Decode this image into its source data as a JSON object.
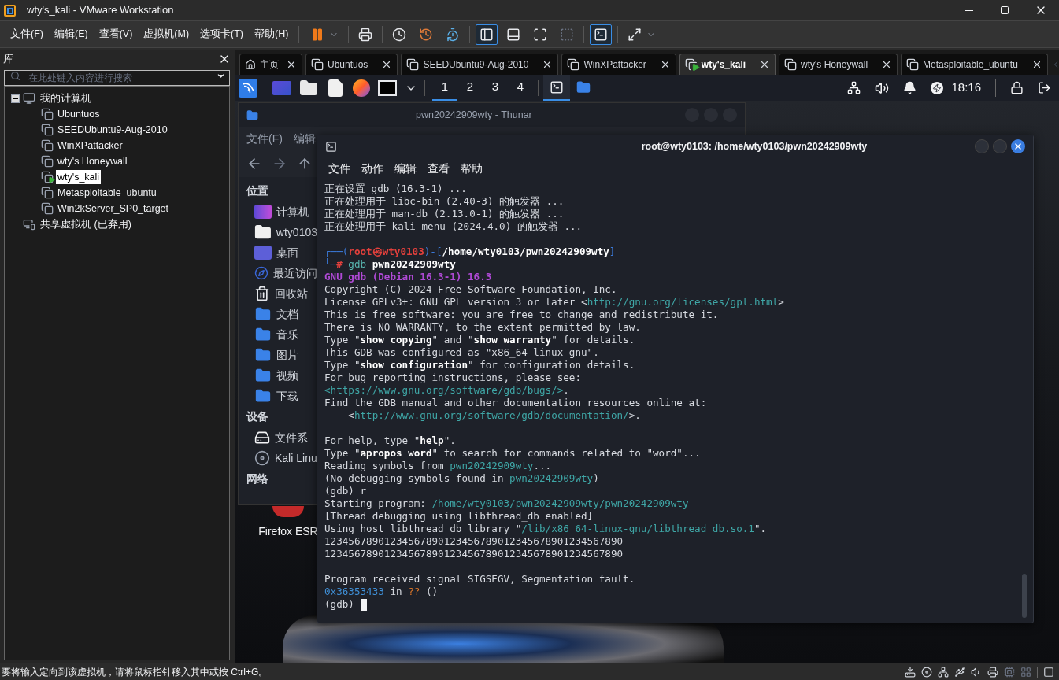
{
  "window": {
    "title": "wty's_kali - VMware Workstation"
  },
  "menu": [
    "文件(F)",
    "编辑(E)",
    "查看(V)",
    "虚拟机(M)",
    "选项卡(T)",
    "帮助(H)"
  ],
  "toolbar": [
    {
      "kind": "pause",
      "selected": false
    },
    {
      "kind": "send-keys",
      "selected": false
    },
    {
      "kind": "snapshot",
      "selected": false
    },
    {
      "kind": "revert",
      "selected": false
    },
    {
      "kind": "manage-snapshots",
      "selected": false
    },
    {
      "kind": "library",
      "selected": true
    },
    {
      "kind": "thumbnails",
      "selected": false
    },
    {
      "kind": "fullscreen",
      "selected": false
    },
    {
      "kind": "unity",
      "selected": false
    },
    {
      "kind": "console",
      "selected": true
    },
    {
      "kind": "stretch",
      "selected": false
    }
  ],
  "library": {
    "title": "库",
    "search": {
      "placeholder": "在此处键入内容进行搜索"
    },
    "tree": [
      {
        "label": "我的计算机",
        "kind": "computer",
        "expanded": true,
        "children": [
          {
            "label": "Ubuntuos",
            "selected": false,
            "running": false
          },
          {
            "label": "SEEDUbuntu9-Aug-2010",
            "selected": false,
            "running": false
          },
          {
            "label": "WinXPattacker",
            "selected": false,
            "running": false
          },
          {
            "label": "wty's Honeywall",
            "selected": false,
            "running": false
          },
          {
            "label": "wty's_kali",
            "selected": true,
            "running": true
          },
          {
            "label": "Metasploitable_ubuntu",
            "selected": false,
            "running": false
          },
          {
            "label": "Win2kServer_SP0_target",
            "selected": false,
            "running": false
          }
        ]
      },
      {
        "label": "共享虚拟机 (已弃用)",
        "kind": "shared"
      }
    ]
  },
  "tabs": [
    {
      "label": "主页",
      "kind": "home",
      "selected": false
    },
    {
      "label": "Ubuntuos",
      "kind": "vm",
      "selected": false,
      "running": false
    },
    {
      "label": "SEEDUbuntu9-Aug-2010",
      "kind": "vm",
      "selected": false,
      "running": false
    },
    {
      "label": "WinXPattacker",
      "kind": "vm",
      "selected": false,
      "running": false
    },
    {
      "label": "wty's_kali",
      "kind": "vm",
      "selected": true,
      "running": true
    },
    {
      "label": "wty's Honeywall",
      "kind": "vm",
      "selected": false,
      "running": false
    },
    {
      "label": "Metasploitable_ubuntu",
      "kind": "vm",
      "selected": false,
      "running": false
    }
  ],
  "panel": {
    "workspaces": [
      {
        "label": "1",
        "selected": true
      },
      {
        "label": "2",
        "selected": false
      },
      {
        "label": "3",
        "selected": false
      },
      {
        "label": "4",
        "selected": false
      }
    ],
    "tasks": [
      {
        "kind": "terminal",
        "selected": true
      },
      {
        "kind": "folder",
        "selected": false
      }
    ],
    "clock": "18:16"
  },
  "file_manager": {
    "title": "pwn20242909wty - Thunar",
    "menu": [
      "文件(F)",
      "编辑"
    ],
    "sections": [
      {
        "heading": "位置",
        "items": [
          {
            "label": "计算机",
            "kind": "computer"
          },
          {
            "label": "wty0103",
            "kind": "home"
          },
          {
            "label": "桌面",
            "kind": "desktop"
          },
          {
            "label": "最近访问",
            "kind": "recent"
          },
          {
            "label": "回收站",
            "kind": "trash"
          },
          {
            "label": "文档",
            "kind": "folder"
          },
          {
            "label": "音乐",
            "kind": "folder"
          },
          {
            "label": "图片",
            "kind": "folder"
          },
          {
            "label": "视频",
            "kind": "folder"
          },
          {
            "label": "下载",
            "kind": "folder"
          }
        ]
      },
      {
        "heading": "设备",
        "items": [
          {
            "label": "文件系",
            "kind": "drive"
          },
          {
            "label": "Kali Linu",
            "kind": "disc"
          }
        ]
      },
      {
        "heading": "网络"
      }
    ]
  },
  "desktop_icons": [
    {
      "label": "Firefox ESR"
    }
  ],
  "terminal": {
    "title": "root@wty0103: /home/wty0103/pwn20242909wty",
    "menu": [
      "文件",
      "动作",
      "编辑",
      "查看",
      "帮助"
    ],
    "lines": [
      {
        "segments": [
          {
            "text": "正在设置 gdb (16.3-1) ...",
            "kind": "text"
          }
        ]
      },
      {
        "segments": [
          {
            "text": "正在处理用于 libc-bin (2.40-3) 的触发器 ...",
            "kind": "text"
          }
        ]
      },
      {
        "segments": [
          {
            "text": "正在处理用于 man-db (2.13.0-1) 的触发器 ...",
            "kind": "text"
          }
        ]
      },
      {
        "segments": [
          {
            "text": "正在处理用于 kali-menu (2024.4.0) 的触发器 ...",
            "kind": "text"
          }
        ]
      },
      {
        "gap_before": true,
        "segments": [
          {
            "text": "┌──(",
            "kind": "frame"
          },
          {
            "text": "root㉿wty0103",
            "kind": "user"
          },
          {
            "text": ")-[",
            "kind": "frame"
          },
          {
            "text": "/home/wty0103/pwn20242909wty",
            "kind": "bold"
          },
          {
            "text": "]",
            "kind": "frame"
          }
        ]
      },
      {
        "segments": [
          {
            "text": "└─",
            "kind": "frame"
          },
          {
            "text": "# ",
            "kind": "user"
          },
          {
            "text": "gdb",
            "kind": "command"
          },
          {
            "text": " pwn20242909wty",
            "kind": "bold"
          }
        ]
      },
      {
        "segments": [
          {
            "text": "GNU gdb (Debian 16.3-1) 16.3",
            "kind": "banner"
          }
        ]
      },
      {
        "segments": [
          {
            "text": "Copyright (C) 2024 Free Software Foundation, Inc.",
            "kind": "text"
          }
        ]
      },
      {
        "segments": [
          {
            "text": "License GPLv3+: GNU GPL version 3 or later <",
            "kind": "text"
          },
          {
            "text": "http://gnu.org/licenses/gpl.html",
            "kind": "link"
          },
          {
            "text": ">",
            "kind": "text"
          }
        ]
      },
      {
        "segments": [
          {
            "text": "This is free software: you are free to change and redistribute it.",
            "kind": "text"
          }
        ]
      },
      {
        "segments": [
          {
            "text": "There is NO WARRANTY, to the extent permitted by law.",
            "kind": "text"
          }
        ]
      },
      {
        "segments": [
          {
            "text": "Type \"",
            "kind": "text"
          },
          {
            "text": "show copying",
            "kind": "bold"
          },
          {
            "text": "\" and \"",
            "kind": "text"
          },
          {
            "text": "show warranty",
            "kind": "bold"
          },
          {
            "text": "\" for details.",
            "kind": "text"
          }
        ]
      },
      {
        "segments": [
          {
            "text": "This GDB was configured as \"x86_64-linux-gnu\".",
            "kind": "text"
          }
        ]
      },
      {
        "segments": [
          {
            "text": "Type \"",
            "kind": "text"
          },
          {
            "text": "show configuration",
            "kind": "bold"
          },
          {
            "text": "\" for configuration details.",
            "kind": "text"
          }
        ]
      },
      {
        "segments": [
          {
            "text": "For bug reporting instructions, please see:",
            "kind": "text"
          }
        ]
      },
      {
        "segments": [
          {
            "text": "<https://www.gnu.org/software/gdb/bugs/>",
            "kind": "link"
          },
          {
            "text": ".",
            "kind": "text"
          }
        ]
      },
      {
        "segments": [
          {
            "text": "Find the GDB manual and other documentation resources online at:",
            "kind": "text"
          }
        ]
      },
      {
        "segments": [
          {
            "text": "    <",
            "kind": "text"
          },
          {
            "text": "http://www.gnu.org/software/gdb/documentation/",
            "kind": "link"
          },
          {
            "text": ">.",
            "kind": "text"
          }
        ]
      },
      {
        "gap_before": true,
        "segments": [
          {
            "text": "For help, type \"",
            "kind": "text"
          },
          {
            "text": "help",
            "kind": "bold"
          },
          {
            "text": "\".",
            "kind": "text"
          }
        ]
      },
      {
        "segments": [
          {
            "text": "Type \"",
            "kind": "text"
          },
          {
            "text": "apropos word",
            "kind": "bold"
          },
          {
            "text": "\" to search for commands related to \"word\"...",
            "kind": "text"
          }
        ]
      },
      {
        "segments": [
          {
            "text": "Reading symbols from ",
            "kind": "text"
          },
          {
            "text": "pwn20242909wty",
            "kind": "link"
          },
          {
            "text": "...",
            "kind": "text"
          }
        ]
      },
      {
        "segments": [
          {
            "text": "(No debugging symbols found in ",
            "kind": "text"
          },
          {
            "text": "pwn20242909wty",
            "kind": "link"
          },
          {
            "text": ")",
            "kind": "text"
          }
        ]
      },
      {
        "segments": [
          {
            "text": "(gdb) r",
            "kind": "text"
          }
        ]
      },
      {
        "segments": [
          {
            "text": "Starting program: ",
            "kind": "text"
          },
          {
            "text": "/home/wty0103/pwn20242909wty/pwn20242909wty",
            "kind": "link"
          }
        ]
      },
      {
        "segments": [
          {
            "text": "[Thread debugging using libthread_db enabled]",
            "kind": "text"
          }
        ]
      },
      {
        "segments": [
          {
            "text": "Using host libthread_db library \"",
            "kind": "text"
          },
          {
            "text": "/lib/x86_64-linux-gnu/libthread_db.so.1",
            "kind": "link"
          },
          {
            "text": "\".",
            "kind": "text"
          }
        ]
      },
      {
        "segments": [
          {
            "text": "12345678901234567890123456789012345678901234567890",
            "kind": "text"
          }
        ]
      },
      {
        "segments": [
          {
            "text": "12345678901234567890123456789012345678901234567890",
            "kind": "text"
          }
        ]
      },
      {
        "gap_before": true,
        "segments": [
          {
            "text": "Program received signal SIGSEGV, Segmentation fault.",
            "kind": "text"
          }
        ]
      },
      {
        "segments": [
          {
            "text": "0x36353433",
            "kind": "address"
          },
          {
            "text": " in ",
            "kind": "text"
          },
          {
            "text": "??",
            "kind": "unknown"
          },
          {
            "text": " ()",
            "kind": "text"
          }
        ]
      },
      {
        "segments": [
          {
            "text": "(gdb) ",
            "kind": "text"
          }
        ],
        "cursor": true
      }
    ]
  },
  "status_bar": {
    "text": "要将输入定向到该虚拟机，请将鼠标指针移入其中或按 Ctrl+G。"
  }
}
